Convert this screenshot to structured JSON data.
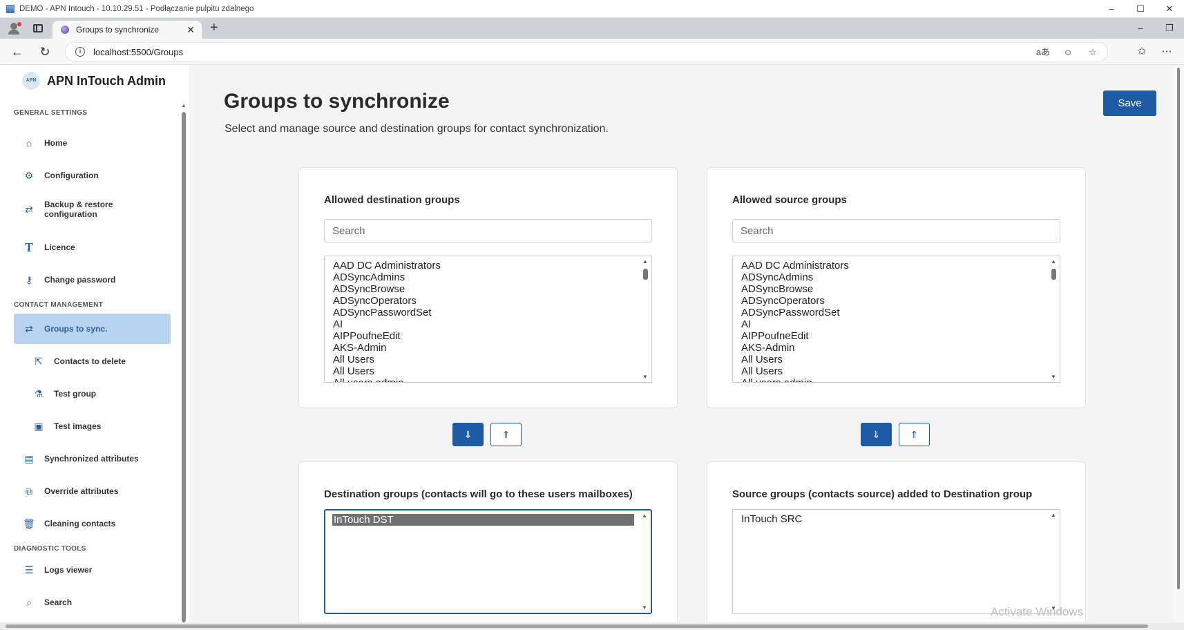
{
  "rdp": {
    "title": "DEMO - APN Intouch - 10.10.29.51 - Podłączanie pulpitu zdalnego",
    "controls": [
      "–",
      "☐",
      "✕"
    ]
  },
  "browser": {
    "tab_title": "Groups to synchronize",
    "tab_close": "✕",
    "new_tab": "+",
    "window_controls": [
      "–",
      "❐"
    ],
    "url": "localhost:5500/Groups",
    "nav": {
      "back": "←",
      "reload": "↻"
    },
    "omni_icons": [
      "aあ",
      "☺",
      "☆"
    ],
    "toolbar_icons": [
      "✩",
      "⋯"
    ]
  },
  "sidebar": {
    "brand_logo": "APN",
    "brand_name": "APN InTouch Admin",
    "sections": {
      "general": "GENERAL SETTINGS",
      "contacts": "CONTACT MANAGEMENT",
      "diagnostic": "DIAGNOSTIC TOOLS"
    },
    "items": [
      {
        "label": "Home",
        "icon": "home-icon"
      },
      {
        "label": "Configuration",
        "icon": "gear-icon"
      },
      {
        "label": "Backup & restore\nconfiguration",
        "icon": "swap-icon"
      },
      {
        "label": "Licence",
        "icon": "text-icon"
      },
      {
        "label": "Change password",
        "icon": "key-icon"
      },
      {
        "label": "Groups to sync.",
        "icon": "swap-icon",
        "active": true
      },
      {
        "label": "Contacts to delete",
        "icon": "export-icon"
      },
      {
        "label": "Test group",
        "icon": "flask-icon"
      },
      {
        "label": "Test images",
        "icon": "image-icon"
      },
      {
        "label": "Synchronized attributes",
        "icon": "table-icon"
      },
      {
        "label": "Override attributes",
        "icon": "override-icon"
      },
      {
        "label": "Cleaning contacts",
        "icon": "trash-icon"
      },
      {
        "label": "Logs viewer",
        "icon": "list-icon"
      },
      {
        "label": "Search",
        "icon": "search-icon"
      }
    ]
  },
  "main": {
    "title": "Groups to synchronize",
    "subtitle": "Select and manage source and destination groups for contact synchronization.",
    "save_label": "Save",
    "allowed_destination": {
      "heading": "Allowed destination groups",
      "search_placeholder": "Search",
      "options": [
        "AAD DC Administrators",
        "ADSyncAdmins",
        "ADSyncBrowse",
        "ADSyncOperators",
        "ADSyncPasswordSet",
        "AI",
        "AIPPoufneEdit",
        "AKS-Admin",
        "All Users",
        "All Users",
        "All users admin"
      ]
    },
    "allowed_source": {
      "heading": "Allowed source groups",
      "search_placeholder": "Search",
      "options": [
        "AAD DC Administrators",
        "ADSyncAdmins",
        "ADSyncBrowse",
        "ADSyncOperators",
        "ADSyncPasswordSet",
        "AI",
        "AIPPoufneEdit",
        "AKS-Admin",
        "All Users",
        "All Users",
        "All users admin"
      ]
    },
    "move_down_label": "⇓",
    "move_up_label": "⇑",
    "destination_groups": {
      "heading": "Destination groups (contacts will go to these users mailboxes)",
      "options": [
        "InTouch DST"
      ],
      "selected": "InTouch DST"
    },
    "source_groups": {
      "heading": "Source groups (contacts source) added to Destination group",
      "options": [
        "InTouch SRC"
      ]
    },
    "watermark": "Activate Windows"
  }
}
